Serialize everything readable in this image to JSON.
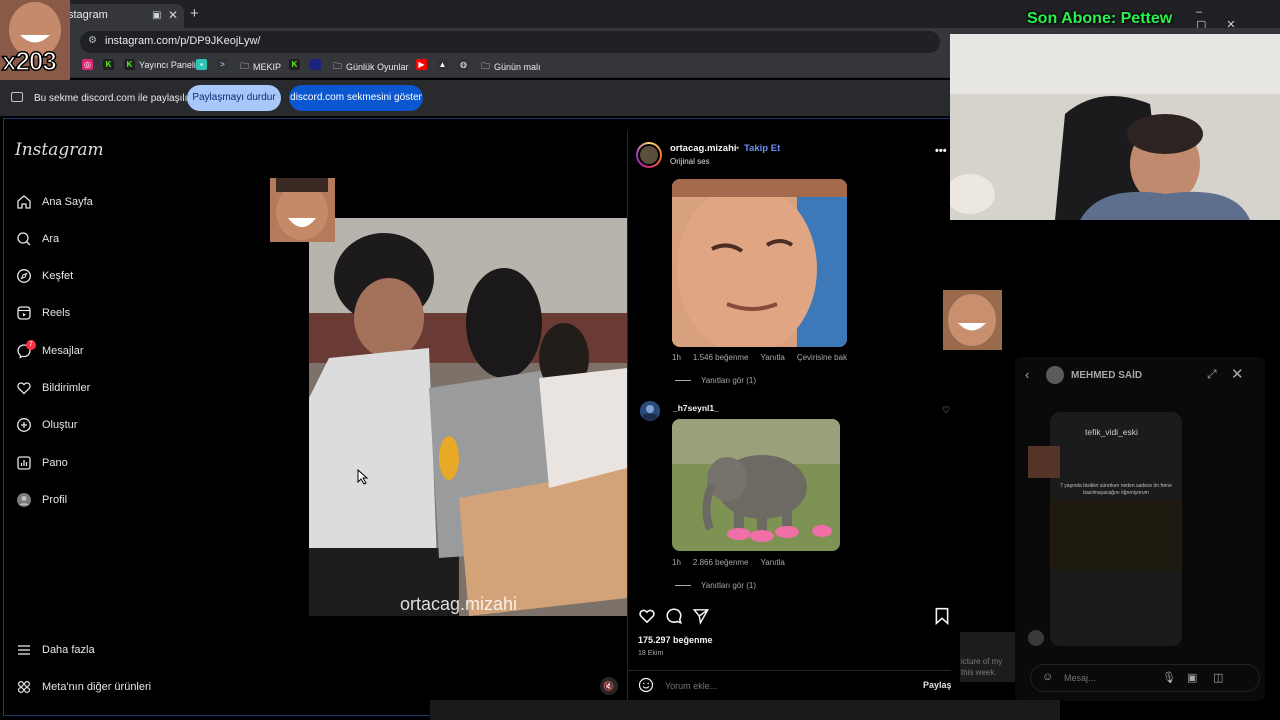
{
  "browser": {
    "tab_title": "stagram",
    "url": "instagram.com/p/DP9JKeojLyw/",
    "bookmarks": [
      {
        "label": "Yayıncı Paneli",
        "icon": "kick-icon"
      },
      {
        "label": "MEKIP",
        "icon": "folder-icon"
      },
      {
        "label": "Günlük Oyunlar",
        "icon": "folder-icon"
      },
      {
        "label": "Günün malı",
        "icon": "folder-icon"
      }
    ],
    "share_notice": "Bu sekme discord.com ile paylaşılıyor",
    "stop_sharing": "Paylaşmayı durdur",
    "show_tab": "discord.com sekmesini göster"
  },
  "stream": {
    "subscriber_text": "Son Abone: Pettew",
    "multiplier": "x203"
  },
  "sidebar": {
    "logo": "Instagram",
    "items": [
      {
        "label": "Ana Sayfa",
        "icon": "home-icon"
      },
      {
        "label": "Ara",
        "icon": "search-icon"
      },
      {
        "label": "Keşfet",
        "icon": "compass-icon"
      },
      {
        "label": "Reels",
        "icon": "reels-icon"
      },
      {
        "label": "Mesajlar",
        "icon": "messenger-icon",
        "badge": "7"
      },
      {
        "label": "Bildirimler",
        "icon": "heart-icon"
      },
      {
        "label": "Oluştur",
        "icon": "plus-icon"
      },
      {
        "label": "Pano",
        "icon": "dashboard-icon"
      },
      {
        "label": "Profil",
        "icon": "avatar-icon"
      }
    ],
    "more": "Daha fazla",
    "meta": "Meta'nın diğer ürünleri"
  },
  "video": {
    "watermark": "ortacag.mizahi"
  },
  "post": {
    "username": "ortacag.mizahi",
    "follow": "Takip Et",
    "audio": "Orijinal ses",
    "comments": [
      {
        "time": "1h",
        "likes": "1.546 beğenme",
        "reply": "Yanıtla",
        "translate": "Çevirisine bak",
        "view_replies": "Yanıtları gör (1)"
      },
      {
        "username": "_h7seynl1_",
        "time": "1h",
        "likes": "2.866 beğenme",
        "reply": "Yanıtla",
        "view_replies": "Yanıtları gör (1)"
      }
    ],
    "like_count": "175.297 beğenme",
    "date": "18 Ekim",
    "comment_placeholder": "Yorum ekle...",
    "share": "Paylaş"
  },
  "dm": {
    "name": "MEHMED SAİD",
    "sender": "tefik_vidi_eski",
    "caption": "7 yaşında bisiklet sürerken neden sadece ön frene basılmayacağını öğreniyorum",
    "placeholder": "Mesaj..."
  },
  "background_snippet": "icture of my\nthis week."
}
